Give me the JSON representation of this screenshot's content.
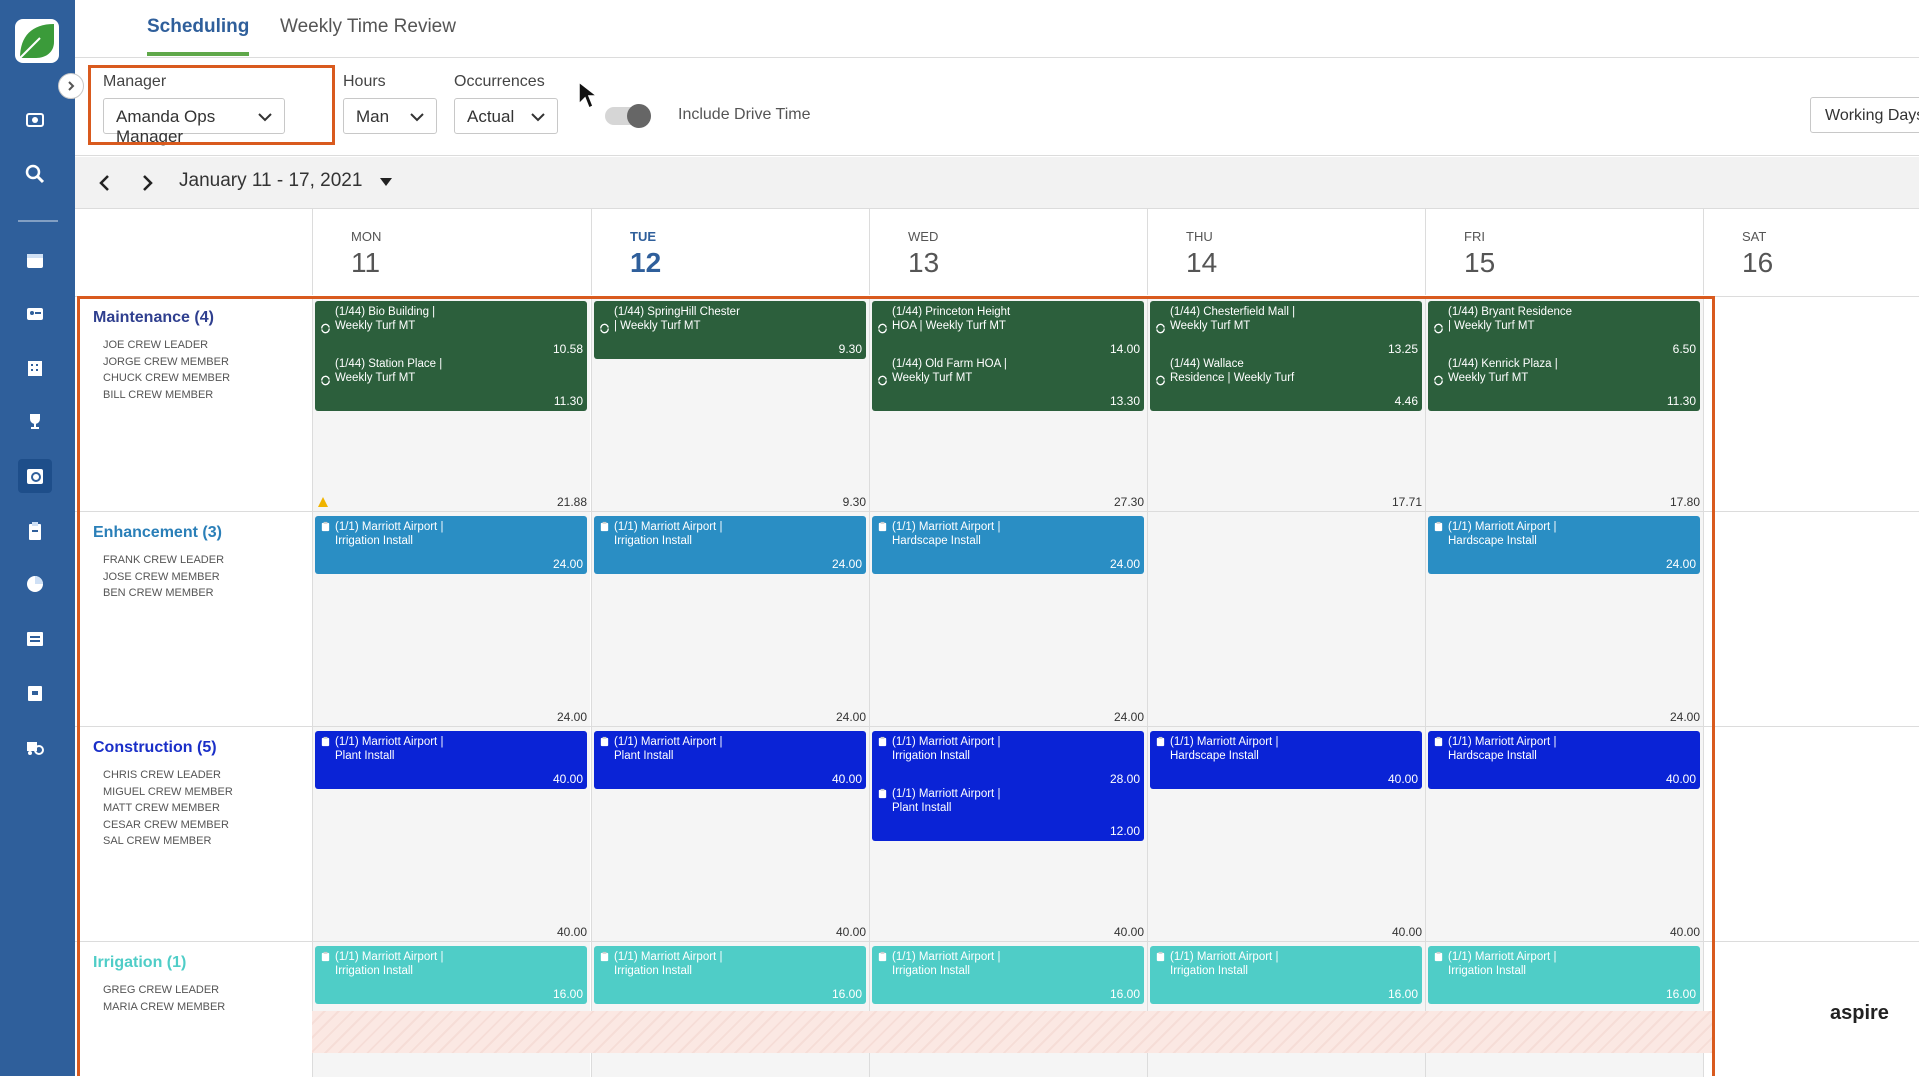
{
  "tabs": [
    {
      "label": "Scheduling",
      "active": true
    },
    {
      "label": "Weekly Time Review",
      "active": false
    }
  ],
  "filters": {
    "manager": {
      "label": "Manager",
      "value": "Amanda Ops Manager"
    },
    "hours": {
      "label": "Hours",
      "value": "Man"
    },
    "occurrences": {
      "label": "Occurrences",
      "value": "Actual"
    },
    "drive_time_label": "Include Drive Time",
    "working_days": "Working Days"
  },
  "date_range": "January 11 - 17, 2021",
  "days": [
    {
      "name": "MON",
      "num": "11",
      "today": false
    },
    {
      "name": "TUE",
      "num": "12",
      "today": true
    },
    {
      "name": "WED",
      "num": "13",
      "today": false
    },
    {
      "name": "THU",
      "num": "14",
      "today": false
    },
    {
      "name": "FRI",
      "num": "15",
      "today": false
    },
    {
      "name": "SAT",
      "num": "16",
      "today": false
    }
  ],
  "colors": {
    "sidebar": "#2f5f9b",
    "maintenance": "#2c5f3c",
    "enhancement": "#2a8ec4",
    "construction": "#0a23d6",
    "irrigation": "#4fcdc7",
    "highlight": "#d95a1e"
  },
  "sidebar_icons": [
    "camera-icon",
    "search-icon",
    "calendar-icon",
    "contact-card-icon",
    "building-icon",
    "trophy-icon",
    "schedule-icon",
    "clipboard-icon",
    "pie-chart-icon",
    "invoice-icon",
    "archive-icon",
    "truck-settings-icon"
  ],
  "crews": [
    {
      "name": "Maintenance (4)",
      "name_color": "#2f3f8f",
      "members": [
        "Joe Crew Leader",
        "Jorge Crew Member",
        "Chuck Crew Member",
        "Bill Crew Member"
      ],
      "totals": [
        "21.88",
        "9.30",
        "27.30",
        "17.71",
        "17.80"
      ],
      "warning": true,
      "jobs": [
        {
          "day": 0,
          "slot": 0,
          "line1": "(1/44) Bio Building |",
          "line2": "Weekly Turf MT",
          "hours": "10.58",
          "icon": "recur"
        },
        {
          "day": 0,
          "slot": 1,
          "line1": "(1/44) Station Place |",
          "line2": "Weekly Turf MT",
          "hours": "11.30",
          "icon": "recur"
        },
        {
          "day": 1,
          "slot": 0,
          "line1": "(1/44) SpringHill Chester",
          "line2": "| Weekly Turf MT",
          "hours": "9.30",
          "icon": "recur"
        },
        {
          "day": 2,
          "slot": 0,
          "line1": "(1/44) Princeton Height",
          "line2": "HOA | Weekly Turf MT",
          "hours": "14.00",
          "icon": "recur"
        },
        {
          "day": 2,
          "slot": 1,
          "line1": "(1/44) Old Farm HOA |",
          "line2": "Weekly Turf MT",
          "hours": "13.30",
          "icon": "recur"
        },
        {
          "day": 3,
          "slot": 0,
          "line1": "(1/44) Chesterfield Mall |",
          "line2": "Weekly Turf MT",
          "hours": "13.25",
          "icon": "recur"
        },
        {
          "day": 3,
          "slot": 1,
          "line1": "(1/44) Wallace",
          "line2": "Residence | Weekly Turf",
          "hours": "4.46",
          "icon": "recur"
        },
        {
          "day": 4,
          "slot": 0,
          "line1": "(1/44) Bryant Residence",
          "line2": "| Weekly Turf MT",
          "hours": "6.50",
          "icon": "recur"
        },
        {
          "day": 4,
          "slot": 1,
          "line1": "(1/44) Kenrick Plaza |",
          "line2": "Weekly Turf MT",
          "hours": "11.30",
          "icon": "recur"
        }
      ]
    },
    {
      "name": "Enhancement (3)",
      "name_color": "#2a7fb8",
      "members": [
        "Frank Crew Leader",
        "Jose Crew Member",
        "Ben Crew Member"
      ],
      "totals": [
        "24.00",
        "24.00",
        "24.00",
        "",
        "24.00"
      ],
      "warning": false,
      "jobs": [
        {
          "day": 0,
          "slot": 0,
          "line1": "(1/1) Marriott Airport |",
          "line2": "Irrigation Install",
          "hours": "24.00",
          "icon": "clip"
        },
        {
          "day": 1,
          "slot": 0,
          "line1": "(1/1) Marriott Airport |",
          "line2": "Irrigation Install",
          "hours": "24.00",
          "icon": "clip"
        },
        {
          "day": 2,
          "slot": 0,
          "line1": "(1/1) Marriott Airport |",
          "line2": "Hardscape Install",
          "hours": "24.00",
          "icon": "clip"
        },
        {
          "day": 4,
          "slot": 0,
          "line1": "(1/1) Marriott Airport |",
          "line2": "Hardscape Install",
          "hours": "24.00",
          "icon": "clip"
        }
      ]
    },
    {
      "name": "Construction (5)",
      "name_color": "#1a2fc8",
      "members": [
        "Chris Crew Leader",
        "Miguel Crew Member",
        "Matt Crew Member",
        "Cesar Crew Member",
        "Sal Crew Member"
      ],
      "totals": [
        "40.00",
        "40.00",
        "40.00",
        "40.00",
        "40.00"
      ],
      "warning": false,
      "jobs": [
        {
          "day": 0,
          "slot": 0,
          "line1": "(1/1) Marriott Airport |",
          "line2": "Plant Install",
          "hours": "40.00",
          "icon": "clip"
        },
        {
          "day": 1,
          "slot": 0,
          "line1": "(1/1) Marriott Airport |",
          "line2": "Plant Install",
          "hours": "40.00",
          "icon": "clip"
        },
        {
          "day": 2,
          "slot": 0,
          "line1": "(1/1) Marriott Airport |",
          "line2": "Irrigation Install",
          "hours": "28.00",
          "icon": "clip"
        },
        {
          "day": 2,
          "slot": 1,
          "line1": "(1/1) Marriott Airport |",
          "line2": "Plant Install",
          "hours": "12.00",
          "icon": "clip"
        },
        {
          "day": 3,
          "slot": 0,
          "line1": "(1/1) Marriott Airport |",
          "line2": "Hardscape Install",
          "hours": "40.00",
          "icon": "clip"
        },
        {
          "day": 4,
          "slot": 0,
          "line1": "(1/1) Marriott Airport |",
          "line2": "Hardscape Install",
          "hours": "40.00",
          "icon": "clip"
        }
      ]
    },
    {
      "name": "Irrigation (1)",
      "name_color": "#4fcdc7",
      "members": [
        "Greg Crew Leader",
        "Maria Crew Member"
      ],
      "totals": [
        "",
        "",
        "",
        "",
        ""
      ],
      "warning": false,
      "jobs": [
        {
          "day": 0,
          "slot": 0,
          "line1": "(1/1) Marriott Airport |",
          "line2": "Irrigation Install",
          "hours": "16.00",
          "icon": "clip"
        },
        {
          "day": 1,
          "slot": 0,
          "line1": "(1/1) Marriott Airport |",
          "line2": "Irrigation Install",
          "hours": "16.00",
          "icon": "clip"
        },
        {
          "day": 2,
          "slot": 0,
          "line1": "(1/1) Marriott Airport |",
          "line2": "Irrigation Install",
          "hours": "16.00",
          "icon": "clip"
        },
        {
          "day": 3,
          "slot": 0,
          "line1": "(1/1) Marriott Airport |",
          "line2": "Irrigation Install",
          "hours": "16.00",
          "icon": "clip"
        },
        {
          "day": 4,
          "slot": 0,
          "line1": "(1/1) Marriott Airport |",
          "line2": "Irrigation Install",
          "hours": "16.00",
          "icon": "clip"
        }
      ]
    }
  ],
  "brand": "aspire"
}
